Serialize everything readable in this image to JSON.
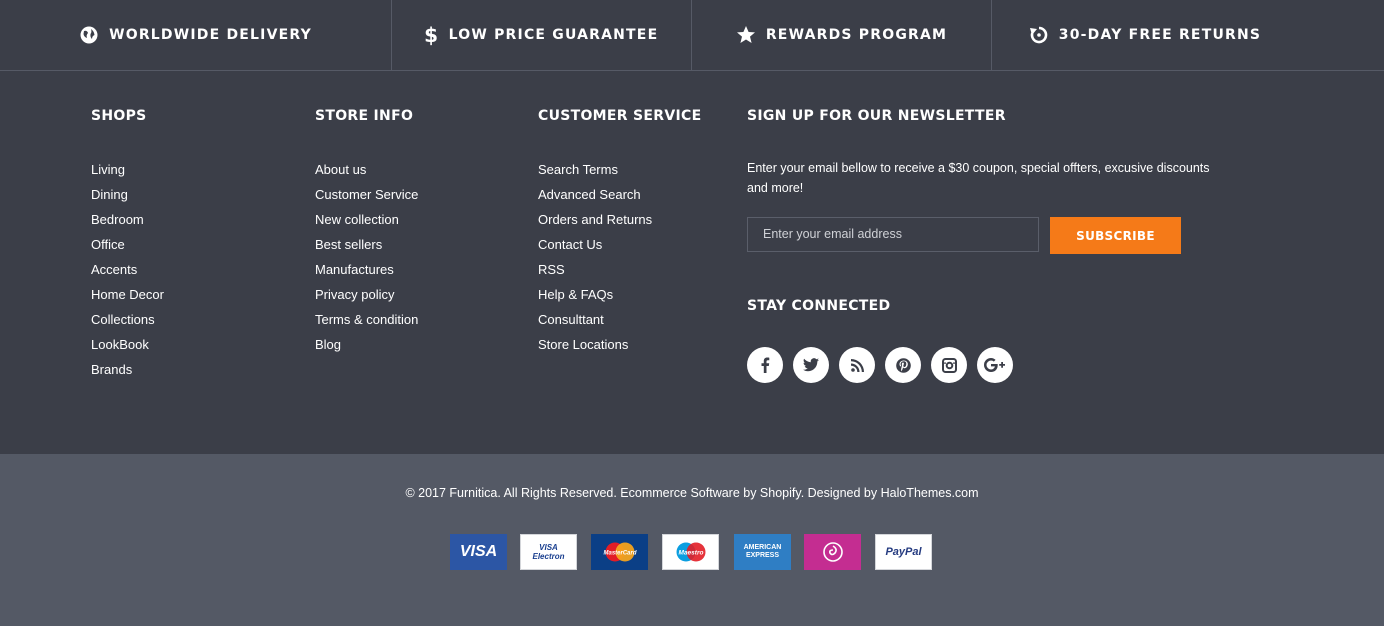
{
  "features": [
    {
      "icon": "globe-icon",
      "label": "WORLDWIDE DELIVERY"
    },
    {
      "icon": "dollar-icon",
      "label": "LOW PRICE GUARANTEE"
    },
    {
      "icon": "star-icon",
      "label": "REWARDS PROGRAM"
    },
    {
      "icon": "refresh-icon",
      "label": "30-DAY FREE RETURNS"
    }
  ],
  "shops": {
    "title": "SHOPS",
    "items": [
      "Living",
      "Dining",
      "Bedroom",
      "Office",
      "Accents",
      "Home Decor",
      "Collections",
      "LookBook",
      "Brands"
    ]
  },
  "store_info": {
    "title": "STORE INFO",
    "items": [
      "About us",
      "Customer Service",
      "New collection",
      "Best sellers",
      "Manufactures",
      "Privacy policy",
      "Terms & condition",
      "Blog"
    ]
  },
  "customer_service": {
    "title": "CUSTOMER SERVICE",
    "items": [
      "Search Terms",
      "Advanced Search",
      "Orders and Returns",
      "Contact Us",
      "RSS",
      "Help & FAQs",
      "Consulttant",
      "Store Locations"
    ]
  },
  "newsletter": {
    "title": "SIGN UP FOR OUR NEWSLETTER",
    "description": "Enter your email bellow to receive a $30 coupon, special offters, excusive discounts and more!",
    "email_placeholder": "Enter your email address",
    "subscribe_label": "SUBSCRIBE"
  },
  "stay_connected": {
    "title": "STAY CONNECTED",
    "icons": [
      "facebook-icon",
      "twitter-icon",
      "rss-icon",
      "pinterest-icon",
      "instagram-icon",
      "google-plus-icon"
    ]
  },
  "copyright": "© 2017 Furnitica. All Rights Reserved. Ecommerce Software by Shopify. Designed by HaloThemes.com",
  "payments": [
    {
      "name": "visa-logo",
      "text": "VISA",
      "bg": "#2c56a5",
      "fg": "#ffffff"
    },
    {
      "name": "visa-electron-logo",
      "text": "VISA Electron",
      "bg": "#ffffff",
      "fg": "#1a3f8f"
    },
    {
      "name": "mastercard-logo",
      "text": "MasterCard",
      "bg": "#0b3f86",
      "fg": "#ffffff"
    },
    {
      "name": "maestro-logo",
      "text": "Maestro",
      "bg": "#ffffff",
      "fg": "#1a3f8f"
    },
    {
      "name": "american-express-logo",
      "text": "AMERICAN EXPRESS",
      "bg": "#2f7ec4",
      "fg": "#ffffff"
    },
    {
      "name": "payment-swirl-logo",
      "text": "",
      "bg": "#c42d91",
      "fg": "#ffffff"
    },
    {
      "name": "paypal-logo",
      "text": "PayPal",
      "bg": "#ffffff",
      "fg": "#253b80"
    }
  ],
  "colors": {
    "footer_bg": "#3b3e48",
    "bottom_bg": "#545965",
    "accent": "#f57a18"
  }
}
